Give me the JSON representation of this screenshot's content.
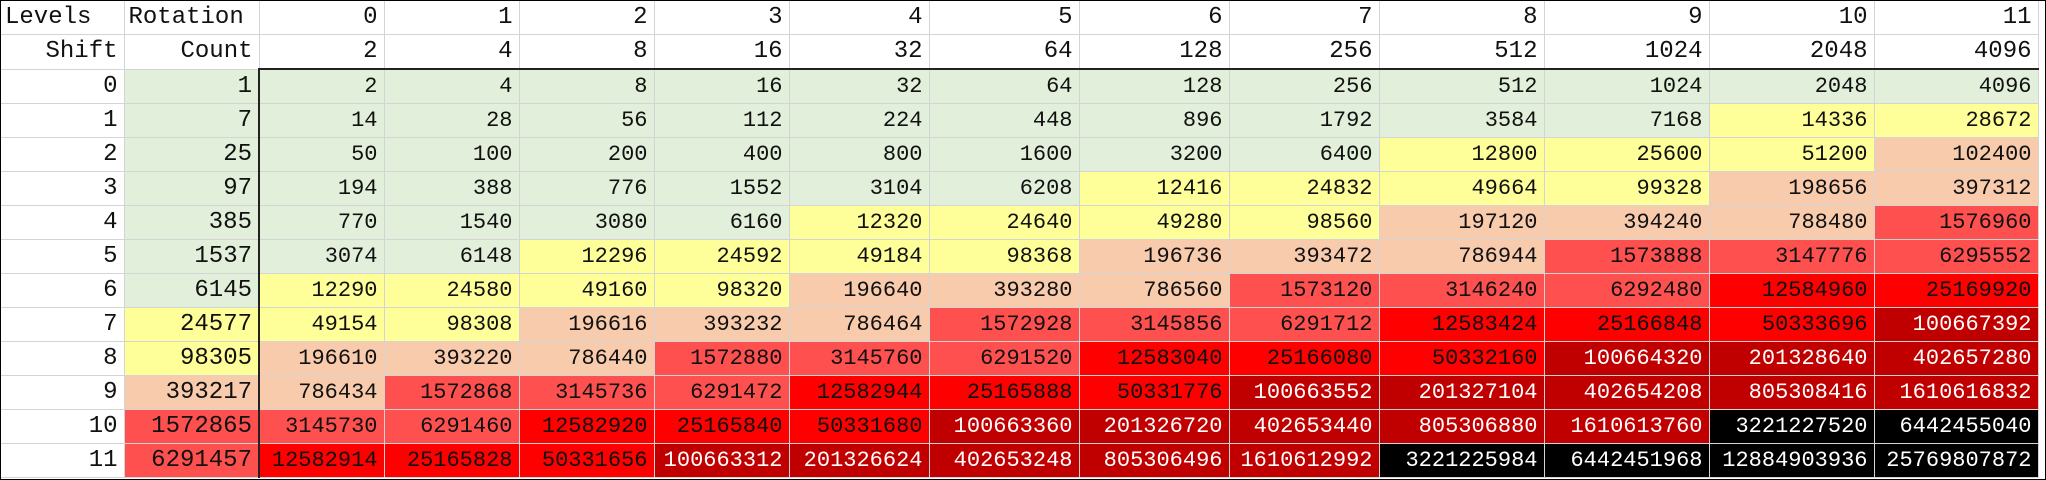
{
  "headers": {
    "row1_label_a": "Levels",
    "row1_label_b": "Rotation",
    "row2_label_a": "Shift",
    "row2_label_b": "Count",
    "levels": [
      "0",
      "1",
      "2",
      "3",
      "4",
      "5",
      "6",
      "7",
      "8",
      "9",
      "10",
      "11"
    ],
    "powers": [
      "2",
      "4",
      "8",
      "16",
      "32",
      "64",
      "128",
      "256",
      "512",
      "1024",
      "2048",
      "4096"
    ]
  },
  "colors": {
    "g": "#e2efda",
    "y": "#ffff99",
    "o": "#f8cbad",
    "r": "#ff5050",
    "rr": "#ff0000",
    "d": "#c00000",
    "k": "#000000"
  },
  "rows": [
    {
      "shift": "0",
      "count": "1",
      "count_color": "g",
      "values": [
        "2",
        "4",
        "8",
        "16",
        "32",
        "64",
        "128",
        "256",
        "512",
        "1024",
        "2048",
        "4096"
      ],
      "colors": [
        "g",
        "g",
        "g",
        "g",
        "g",
        "g",
        "g",
        "g",
        "g",
        "g",
        "g",
        "g"
      ]
    },
    {
      "shift": "1",
      "count": "7",
      "count_color": "g",
      "values": [
        "14",
        "28",
        "56",
        "112",
        "224",
        "448",
        "896",
        "1792",
        "3584",
        "7168",
        "14336",
        "28672"
      ],
      "colors": [
        "g",
        "g",
        "g",
        "g",
        "g",
        "g",
        "g",
        "g",
        "g",
        "g",
        "y",
        "y"
      ]
    },
    {
      "shift": "2",
      "count": "25",
      "count_color": "g",
      "values": [
        "50",
        "100",
        "200",
        "400",
        "800",
        "1600",
        "3200",
        "6400",
        "12800",
        "25600",
        "51200",
        "102400"
      ],
      "colors": [
        "g",
        "g",
        "g",
        "g",
        "g",
        "g",
        "g",
        "g",
        "y",
        "y",
        "y",
        "o"
      ]
    },
    {
      "shift": "3",
      "count": "97",
      "count_color": "g",
      "values": [
        "194",
        "388",
        "776",
        "1552",
        "3104",
        "6208",
        "12416",
        "24832",
        "49664",
        "99328",
        "198656",
        "397312"
      ],
      "colors": [
        "g",
        "g",
        "g",
        "g",
        "g",
        "g",
        "y",
        "y",
        "y",
        "y",
        "o",
        "o"
      ]
    },
    {
      "shift": "4",
      "count": "385",
      "count_color": "g",
      "values": [
        "770",
        "1540",
        "3080",
        "6160",
        "12320",
        "24640",
        "49280",
        "98560",
        "197120",
        "394240",
        "788480",
        "1576960"
      ],
      "colors": [
        "g",
        "g",
        "g",
        "g",
        "y",
        "y",
        "y",
        "y",
        "o",
        "o",
        "o",
        "r"
      ]
    },
    {
      "shift": "5",
      "count": "1537",
      "count_color": "g",
      "values": [
        "3074",
        "6148",
        "12296",
        "24592",
        "49184",
        "98368",
        "196736",
        "393472",
        "786944",
        "1573888",
        "3147776",
        "6295552"
      ],
      "colors": [
        "g",
        "g",
        "y",
        "y",
        "y",
        "y",
        "o",
        "o",
        "o",
        "r",
        "r",
        "r"
      ]
    },
    {
      "shift": "6",
      "count": "6145",
      "count_color": "g",
      "values": [
        "12290",
        "24580",
        "49160",
        "98320",
        "196640",
        "393280",
        "786560",
        "1573120",
        "3146240",
        "6292480",
        "12584960",
        "25169920"
      ],
      "colors": [
        "y",
        "y",
        "y",
        "y",
        "o",
        "o",
        "o",
        "r",
        "r",
        "r",
        "rr",
        "rr"
      ]
    },
    {
      "shift": "7",
      "count": "24577",
      "count_color": "y",
      "values": [
        "49154",
        "98308",
        "196616",
        "393232",
        "786464",
        "1572928",
        "3145856",
        "6291712",
        "12583424",
        "25166848",
        "50333696",
        "100667392"
      ],
      "colors": [
        "y",
        "y",
        "o",
        "o",
        "o",
        "r",
        "r",
        "r",
        "rr",
        "rr",
        "rr",
        "d"
      ]
    },
    {
      "shift": "8",
      "count": "98305",
      "count_color": "y",
      "values": [
        "196610",
        "393220",
        "786440",
        "1572880",
        "3145760",
        "6291520",
        "12583040",
        "25166080",
        "50332160",
        "100664320",
        "201328640",
        "402657280"
      ],
      "colors": [
        "o",
        "o",
        "o",
        "r",
        "r",
        "r",
        "rr",
        "rr",
        "rr",
        "d",
        "d",
        "d"
      ]
    },
    {
      "shift": "9",
      "count": "393217",
      "count_color": "o",
      "values": [
        "786434",
        "1572868",
        "3145736",
        "6291472",
        "12582944",
        "25165888",
        "50331776",
        "100663552",
        "201327104",
        "402654208",
        "805308416",
        "1610616832"
      ],
      "colors": [
        "o",
        "r",
        "r",
        "r",
        "rr",
        "rr",
        "rr",
        "d",
        "d",
        "d",
        "d",
        "d"
      ]
    },
    {
      "shift": "10",
      "count": "1572865",
      "count_color": "r",
      "values": [
        "3145730",
        "6291460",
        "12582920",
        "25165840",
        "50331680",
        "100663360",
        "201326720",
        "402653440",
        "805306880",
        "1610613760",
        "3221227520",
        "6442455040"
      ],
      "colors": [
        "r",
        "r",
        "rr",
        "rr",
        "rr",
        "d",
        "d",
        "d",
        "d",
        "d",
        "k",
        "k"
      ]
    },
    {
      "shift": "11",
      "count": "6291457",
      "count_color": "r",
      "values": [
        "12582914",
        "25165828",
        "50331656",
        "100663312",
        "201326624",
        "402653248",
        "805306496",
        "1610612992",
        "3221225984",
        "6442451968",
        "12884903936",
        "25769807872"
      ],
      "colors": [
        "rr",
        "rr",
        "rr",
        "d",
        "d",
        "d",
        "d",
        "d",
        "k",
        "k",
        "k",
        "k"
      ]
    }
  ]
}
